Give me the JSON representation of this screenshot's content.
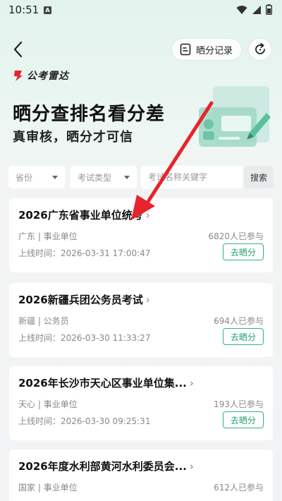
{
  "status_bar": {
    "time": "10:51",
    "notification_letter": "A"
  },
  "header": {
    "record_label": "晒分记录"
  },
  "brand": {
    "name": "公考雷达"
  },
  "hero": {
    "title": "晒分查排名看分差",
    "subtitle": "真审核，晒分才可信"
  },
  "filters": {
    "province": "省份",
    "exam_type": "考试类型",
    "search_placeholder": "考试名称关键字",
    "search_button": "搜索"
  },
  "exams": [
    {
      "title": "2026广东省事业单位统考",
      "chevron": "›",
      "meta": "广东 | 事业单位",
      "participants": "6820人已参与",
      "time": "上线时间：2026-03-31 17:00:47",
      "action": "去晒分"
    },
    {
      "title": "2026新疆兵团公务员考试",
      "chevron": "›",
      "meta": "新疆 | 公务员",
      "participants": "694人已参与",
      "time": "上线时间：2026-03-30 11:33:27",
      "action": "去晒分"
    },
    {
      "title": "2026年长沙市天心区事业单位集...",
      "chevron": "›",
      "meta": "天心 | 事业单位",
      "participants": "193人已参与",
      "time": "上线时间：2026-03-30 09:25:31",
      "action": "去晒分"
    },
    {
      "title": "2026年度水利部黄河水利委员会...",
      "chevron": "›",
      "meta": "国家 | 事业单位",
      "participants": "612人已参与",
      "time": "",
      "action": ""
    }
  ],
  "colors": {
    "accent": "#23a06d",
    "annotation_arrow": "#e8232b",
    "brand_mark": "#e8232b"
  }
}
